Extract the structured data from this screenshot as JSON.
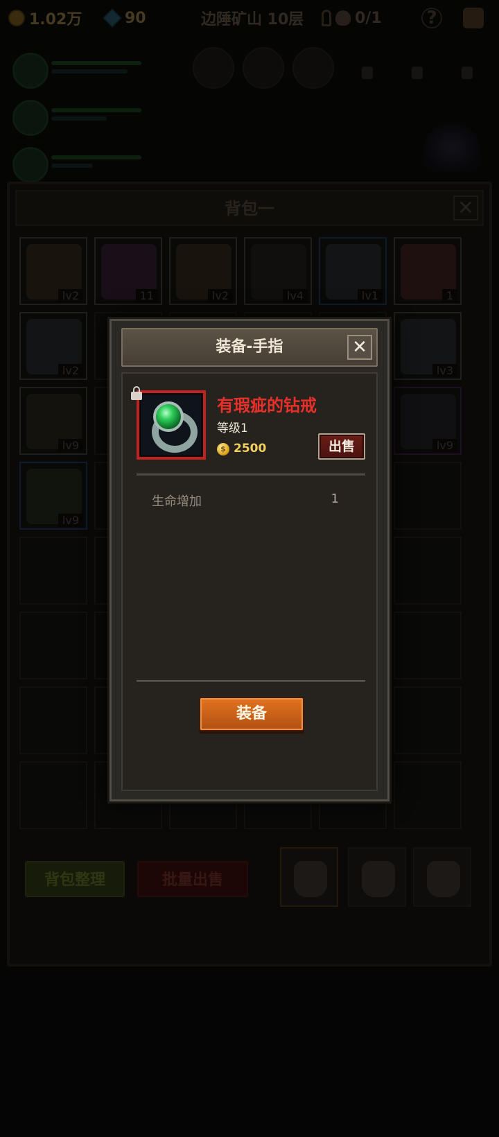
{
  "top_bar": {
    "gold": "1.02万",
    "gems": "90",
    "location": "边陲矿山 10层",
    "boss_kills": "0/1",
    "help": "?"
  },
  "backpack": {
    "title": "背包一",
    "close": "✕",
    "slots": [
      {
        "lvl": "lv2",
        "rarity": "white"
      },
      {
        "lvl": "11",
        "rarity": "white"
      },
      {
        "lvl": "lv2",
        "rarity": "white"
      },
      {
        "lvl": "lv4",
        "rarity": "white"
      },
      {
        "lvl": "lv1",
        "rarity": "blue"
      },
      {
        "lvl": "1",
        "rarity": "white"
      },
      {
        "lvl": "lv2",
        "rarity": "white"
      },
      {
        "lvl": "lv3",
        "rarity": "white"
      },
      {
        "lvl": "lv9",
        "rarity": "white"
      },
      {
        "lvl": "lv9",
        "rarity": "purple"
      },
      {
        "lvl": "lv9",
        "rarity": "blue"
      }
    ],
    "sort_button": "背包整理",
    "bulk_sell_button": "批量出售"
  },
  "modal": {
    "title": "装备-手指",
    "close": "✕",
    "item": {
      "name": "有瑕疵的钻戒",
      "level": "等级1",
      "price": "2500",
      "sell_button": "出售"
    },
    "attributes": [
      {
        "name": "生命增加",
        "value": "1"
      }
    ],
    "equip_button": "装备"
  },
  "colors": {
    "item_name": "#e8302a",
    "equip_button": "#d86a1c",
    "sell_button": "#5a1812",
    "rarity_frame": "#c0221f"
  }
}
